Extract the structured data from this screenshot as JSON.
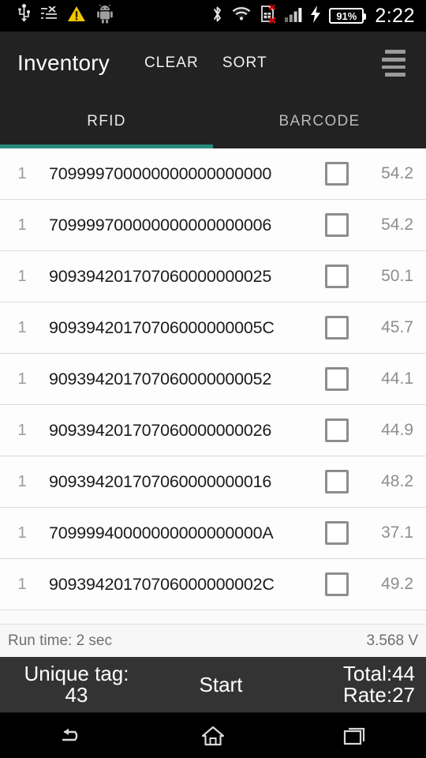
{
  "status_bar": {
    "icons_left": [
      "usb-icon",
      "list-dismiss-icon",
      "warning-triangle-icon",
      "android-robot-icon"
    ],
    "icons_right": [
      "bluetooth-icon",
      "wifi-icon",
      "sim-card-error-icon",
      "signal-bars-icon",
      "charging-bolt-icon"
    ],
    "battery_percent": "91%",
    "time": "2:22"
  },
  "action_bar": {
    "title": "Inventory",
    "clear_label": "CLEAR",
    "sort_label": "SORT",
    "menu_icon": "hamburger-menu-icon"
  },
  "tabs": [
    {
      "label": "RFID",
      "active": true
    },
    {
      "label": "BARCODE",
      "active": false
    }
  ],
  "accent_color": "#2a8a7c",
  "tag_list": {
    "columns": [
      "count",
      "epc",
      "selected",
      "rssi"
    ],
    "rows": [
      {
        "count": "1",
        "epc": "709999700000000000000000",
        "checked": false,
        "rssi": "54.2"
      },
      {
        "count": "1",
        "epc": "709999700000000000000006",
        "checked": false,
        "rssi": "54.2"
      },
      {
        "count": "1",
        "epc": "909394201707060000000025",
        "checked": false,
        "rssi": "50.1"
      },
      {
        "count": "1",
        "epc": "90939420170706000000005C",
        "checked": false,
        "rssi": "45.7"
      },
      {
        "count": "1",
        "epc": "909394201707060000000052",
        "checked": false,
        "rssi": "44.1"
      },
      {
        "count": "1",
        "epc": "909394201707060000000026",
        "checked": false,
        "rssi": "44.9"
      },
      {
        "count": "1",
        "epc": "909394201707060000000016",
        "checked": false,
        "rssi": "48.2"
      },
      {
        "count": "1",
        "epc": "70999940000000000000000A",
        "checked": false,
        "rssi": "37.1"
      },
      {
        "count": "1",
        "epc": "90939420170706000000002C",
        "checked": false,
        "rssi": "49.2"
      }
    ]
  },
  "info_strip": {
    "run_time": "Run time: 2 sec",
    "voltage": "3.568 V"
  },
  "control_bar": {
    "unique_label": "Unique tag:",
    "unique_value": "43",
    "start_label": "Start",
    "total_label": "Total:44",
    "rate_label": "Rate:27"
  },
  "nav_bar": {
    "back_icon": "back-arrow-icon",
    "home_icon": "home-icon",
    "recents_icon": "recent-apps-icon"
  }
}
